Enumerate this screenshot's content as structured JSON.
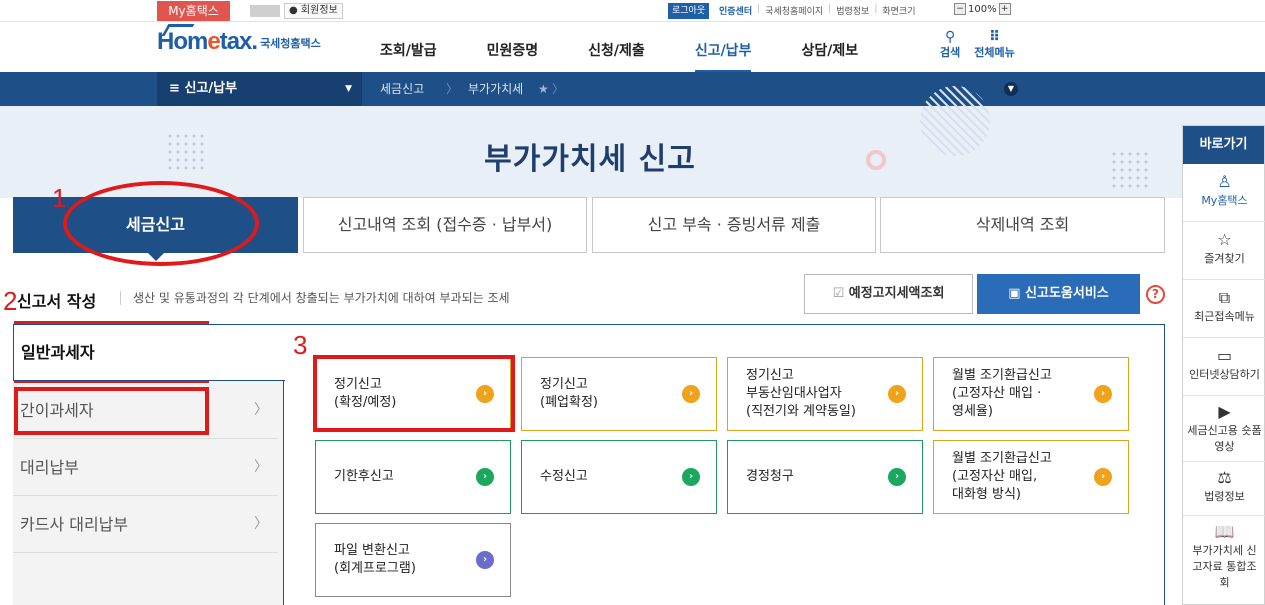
{
  "topbar": {
    "my_hometax": "My홈택스",
    "member_info": "회원정보",
    "logout": "로그아웃",
    "cert_center": "인증센터",
    "links": [
      "국세청홈페이지",
      "법령정보",
      "화면크기"
    ],
    "zoom": "100%",
    "zoom_minus": "−",
    "zoom_plus": "+"
  },
  "header": {
    "logo_main": "Hom",
    "logo_e": "e",
    "logo_tail": "tax.",
    "logo_kr": "국세청홈택스",
    "menu": [
      "조회/발급",
      "민원증명",
      "신청/제출",
      "신고/납부",
      "상담/제보"
    ],
    "active_menu": "신고/납부",
    "search_label": "검색",
    "all_menu_label": "전체메뉴"
  },
  "navbar": {
    "selected": "신고/납부",
    "crumbs": [
      "세금신고",
      "부가가치세"
    ]
  },
  "hero": {
    "title": "부가가치세 신고"
  },
  "tabs": [
    "세금신고",
    "신고내역 조회 (접수증 · 납부서)",
    "신고 부속 · 증빙서류 제출",
    "삭제내역 조회"
  ],
  "section": {
    "title": "신고서 작성",
    "description": "생산 및 유통과정의 각 단계에서 창출되는 부가가치에 대하여 부과되는 조세",
    "notice_button": "예정고지세액조회",
    "help_button": "신고도움서비스",
    "help_icon": "?"
  },
  "left_nav": [
    "일반과세자",
    "간이과세자",
    "대리납부",
    "카드사 대리납부"
  ],
  "cards": [
    {
      "lines": [
        "정기신고",
        "(확정/예정)"
      ],
      "color": "orange"
    },
    {
      "lines": [
        "정기신고",
        "(폐업확정)"
      ],
      "color": "orange"
    },
    {
      "lines": [
        "정기신고",
        "부동산임대사업자",
        "(직전기와 계약동일)"
      ],
      "color": "orange"
    },
    {
      "lines": [
        "월별 조기환급신고",
        "(고정자산 매입 ·",
        "영세율)"
      ],
      "color": "orange"
    },
    {
      "lines": [
        "기한후신고"
      ],
      "color": "green"
    },
    {
      "lines": [
        "수정신고"
      ],
      "color": "green"
    },
    {
      "lines": [
        "경정청구"
      ],
      "color": "green"
    },
    {
      "lines": [
        "월별 조기환급신고",
        "(고정자산 매입,",
        "대화형 방식)"
      ],
      "color": "orange"
    },
    {
      "lines": [
        "파일 변환신고",
        "(회계프로그램)"
      ],
      "color": "gray"
    }
  ],
  "quick_menu": {
    "title": "바로가기",
    "items": [
      "My홈택스",
      "즐겨찾기",
      "최근접속메뉴",
      "인터넷상담하기",
      "세금신고용 숏폼영상",
      "법령정보",
      "부가가치세 신고자료 통합조회"
    ],
    "icons": [
      "person-icon",
      "star-icon",
      "recent-icon",
      "monitor-icon",
      "play-icon",
      "gavel-icon",
      "book-icon"
    ]
  },
  "annotations": [
    "1",
    "2",
    "3"
  ]
}
